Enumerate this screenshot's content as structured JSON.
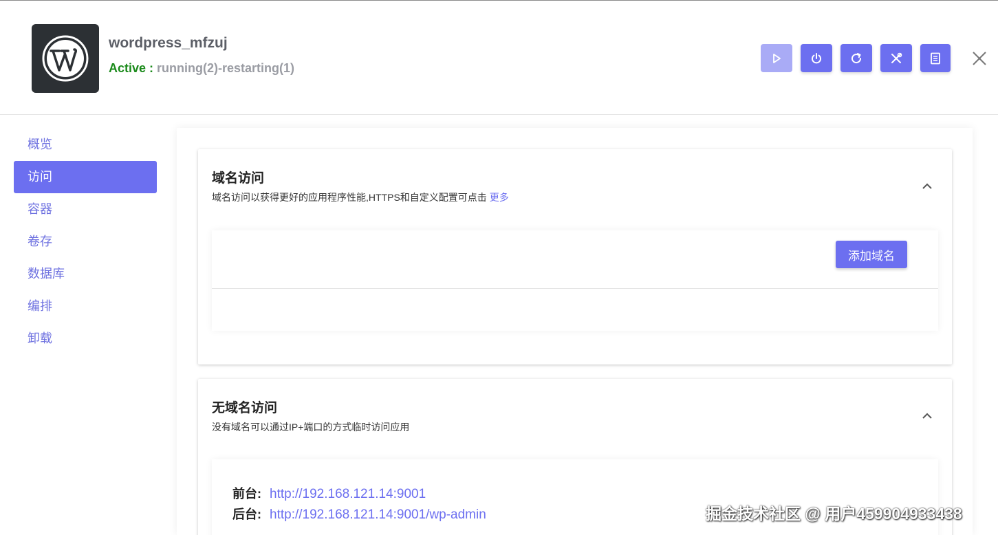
{
  "app": {
    "name": "wordpress_mfzuj",
    "status_label": "Active :",
    "status_detail": "running(2)-restarting(1)",
    "logo_icon": "wordpress-logo-icon"
  },
  "toolbar": {
    "buttons": [
      {
        "icon": "play-icon",
        "state": "disabled"
      },
      {
        "icon": "power-icon",
        "state": "enabled"
      },
      {
        "icon": "restart-icon",
        "state": "enabled"
      },
      {
        "icon": "tools-icon",
        "state": "enabled"
      },
      {
        "icon": "document-icon",
        "state": "enabled"
      }
    ],
    "close_icon": "close-icon"
  },
  "sidebar": {
    "items": [
      {
        "label": "概览",
        "active": false
      },
      {
        "label": "访问",
        "active": true
      },
      {
        "label": "容器",
        "active": false
      },
      {
        "label": "卷存",
        "active": false
      },
      {
        "label": "数据库",
        "active": false
      },
      {
        "label": "编排",
        "active": false
      },
      {
        "label": "卸载",
        "active": false
      }
    ]
  },
  "domain_access": {
    "title": "域名访问",
    "subtitle": "域名访问以获得更好的应用程序性能,HTTPS和自定义配置可点击",
    "more_link": "更多",
    "add_button": "添加域名"
  },
  "no_domain_access": {
    "title": "无域名访问",
    "subtitle": "没有域名可以通过IP+端口的方式临时访问应用",
    "frontend_label": "前台:",
    "frontend_url": "http://192.168.121.14:9001",
    "backend_label": "后台:",
    "backend_url": "http://192.168.121.14:9001/wp-admin"
  },
  "watermark": "掘金技术社区 @ 用户459904933438",
  "colors": {
    "accent": "#6c6ff0",
    "accent_disabled": "#a9abf6",
    "active_green": "#1a8a1a",
    "status_gray": "#9a9ca3"
  }
}
